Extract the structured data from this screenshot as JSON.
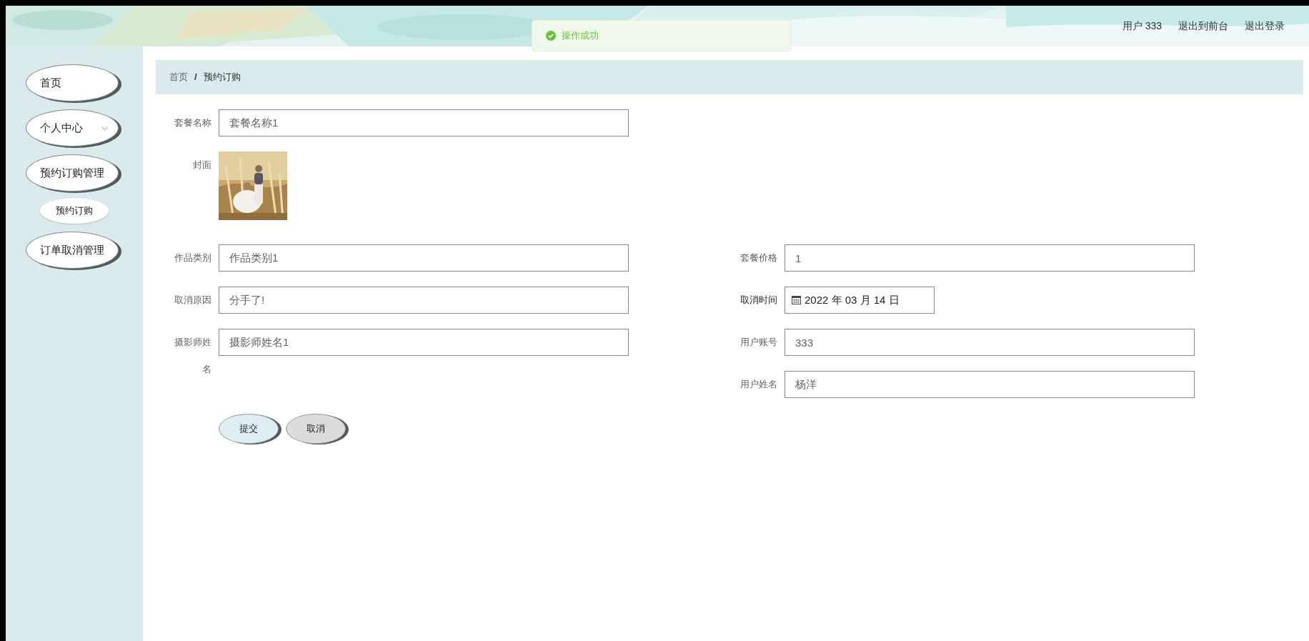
{
  "header": {
    "user_label": "用户 333",
    "links": [
      "退出到前台",
      "退出登录"
    ]
  },
  "toast": {
    "message": "操作成功"
  },
  "sidebar": {
    "items": [
      {
        "label": "首页",
        "kind": "link"
      },
      {
        "label": "个人中心",
        "kind": "submenu",
        "expanded": false
      },
      {
        "label": "预约订购管理",
        "kind": "submenu",
        "expanded": true,
        "children": [
          {
            "label": "预约订购"
          }
        ]
      },
      {
        "label": "订单取消管理",
        "kind": "link"
      }
    ]
  },
  "breadcrumb": {
    "items": [
      "首页",
      "预约订购"
    ],
    "separator": "/"
  },
  "form": {
    "top_fields": [
      {
        "label": "套餐名称",
        "kind": "text",
        "value": "套餐名称1"
      },
      {
        "label": "封面"
      }
    ],
    "left_fields": [
      {
        "label": "作品类别",
        "kind": "text",
        "value": "作品类别1"
      },
      {
        "label": "取消原因",
        "kind": "text",
        "value": "分手了!"
      },
      {
        "label": "摄影师姓名",
        "kind": "text",
        "value": "摄影师姓名1"
      }
    ],
    "right_fields": [
      {
        "label": "套餐价格",
        "kind": "text",
        "value": "1"
      },
      {
        "label": "取消时间",
        "kind": "date",
        "value": "2022 年 03 月 14 日"
      },
      {
        "label": "用户账号",
        "kind": "text",
        "value": "333"
      },
      {
        "label": "用户姓名",
        "kind": "text",
        "value": "杨洋"
      }
    ],
    "buttons": [
      {
        "label": "提交",
        "kind": "primary"
      },
      {
        "label": "取消",
        "kind": "secondary"
      }
    ]
  }
}
